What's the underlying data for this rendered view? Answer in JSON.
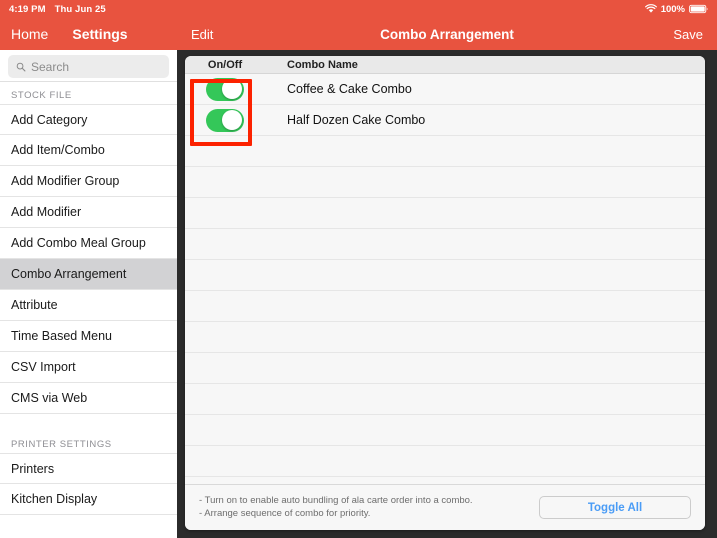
{
  "status_bar": {
    "time": "4:19 PM",
    "date": "Thu Jun 25",
    "battery_percent": "100%",
    "wifi_icon": "wifi-icon",
    "battery_icon": "battery-full-icon"
  },
  "sidebar": {
    "nav": {
      "home_label": "Home",
      "settings_label": "Settings"
    },
    "search": {
      "placeholder": "Search",
      "value": "",
      "icon": "search-icon"
    },
    "sections": [
      {
        "header": "STOCK FILE",
        "items": [
          {
            "label": "Add Category",
            "selected": false
          },
          {
            "label": "Add Item/Combo",
            "selected": false
          },
          {
            "label": "Add Modifier Group",
            "selected": false
          },
          {
            "label": "Add Modifier",
            "selected": false
          },
          {
            "label": "Add Combo Meal Group",
            "selected": false
          },
          {
            "label": "Combo Arrangement",
            "selected": true
          },
          {
            "label": "Attribute",
            "selected": false
          },
          {
            "label": "Time Based Menu",
            "selected": false
          },
          {
            "label": "CSV Import",
            "selected": false
          },
          {
            "label": "CMS via Web",
            "selected": false
          }
        ]
      },
      {
        "header": "PRINTER SETTINGS",
        "items": [
          {
            "label": "Printers",
            "selected": false
          },
          {
            "label": "Kitchen Display",
            "selected": false
          }
        ]
      }
    ]
  },
  "content": {
    "navbar": {
      "edit_label": "Edit",
      "title": "Combo Arrangement",
      "save_label": "Save"
    },
    "table": {
      "columns": {
        "onoff": "On/Off",
        "name": "Combo Name"
      },
      "rows": [
        {
          "name": "Coffee & Cake Combo",
          "enabled": true
        },
        {
          "name": "Half Dozen Cake Combo",
          "enabled": true
        }
      ],
      "empty_row_count": 11
    },
    "footer": {
      "note_1": "- Turn on to enable auto bundling of ala carte order into a combo.",
      "note_2": "- Arrange sequence of combo for priority.",
      "toggle_all_label": "Toggle All"
    }
  },
  "annotation": {
    "color": "#fc2200",
    "label": "toggle-column-highlight"
  },
  "colors": {
    "brand_red": "#e8533f",
    "toggle_green": "#34c759",
    "link_blue": "#4a9cf6",
    "selected_row": "#d2d2d4",
    "annotation_red": "#fc2200"
  }
}
